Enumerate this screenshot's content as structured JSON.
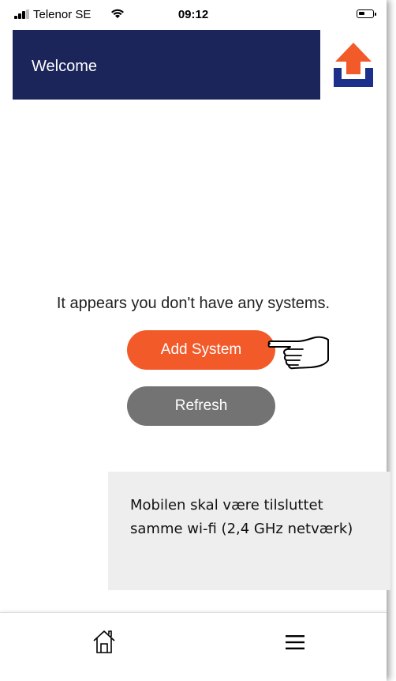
{
  "status_bar": {
    "carrier": "Telenor SE",
    "time": "09:12"
  },
  "header": {
    "title": "Welcome",
    "logo": "upload-arrow-logo"
  },
  "main": {
    "empty_message": "It appears you don't have any systems.",
    "add_button_label": "Add System",
    "refresh_button_label": "Refresh",
    "pointer_icon": "pointing-hand-icon",
    "info_note": "Mobilen skal være tilsluttet samme wi-fi (2,4 GHz netværk)"
  },
  "bottom_nav": {
    "items": [
      {
        "icon": "home-icon"
      },
      {
        "icon": "menu-icon"
      }
    ]
  },
  "colors": {
    "header_bg": "#1c2559",
    "accent": "#f25a29",
    "refresh_bg": "#737373",
    "info_bg": "#eeeeee"
  }
}
